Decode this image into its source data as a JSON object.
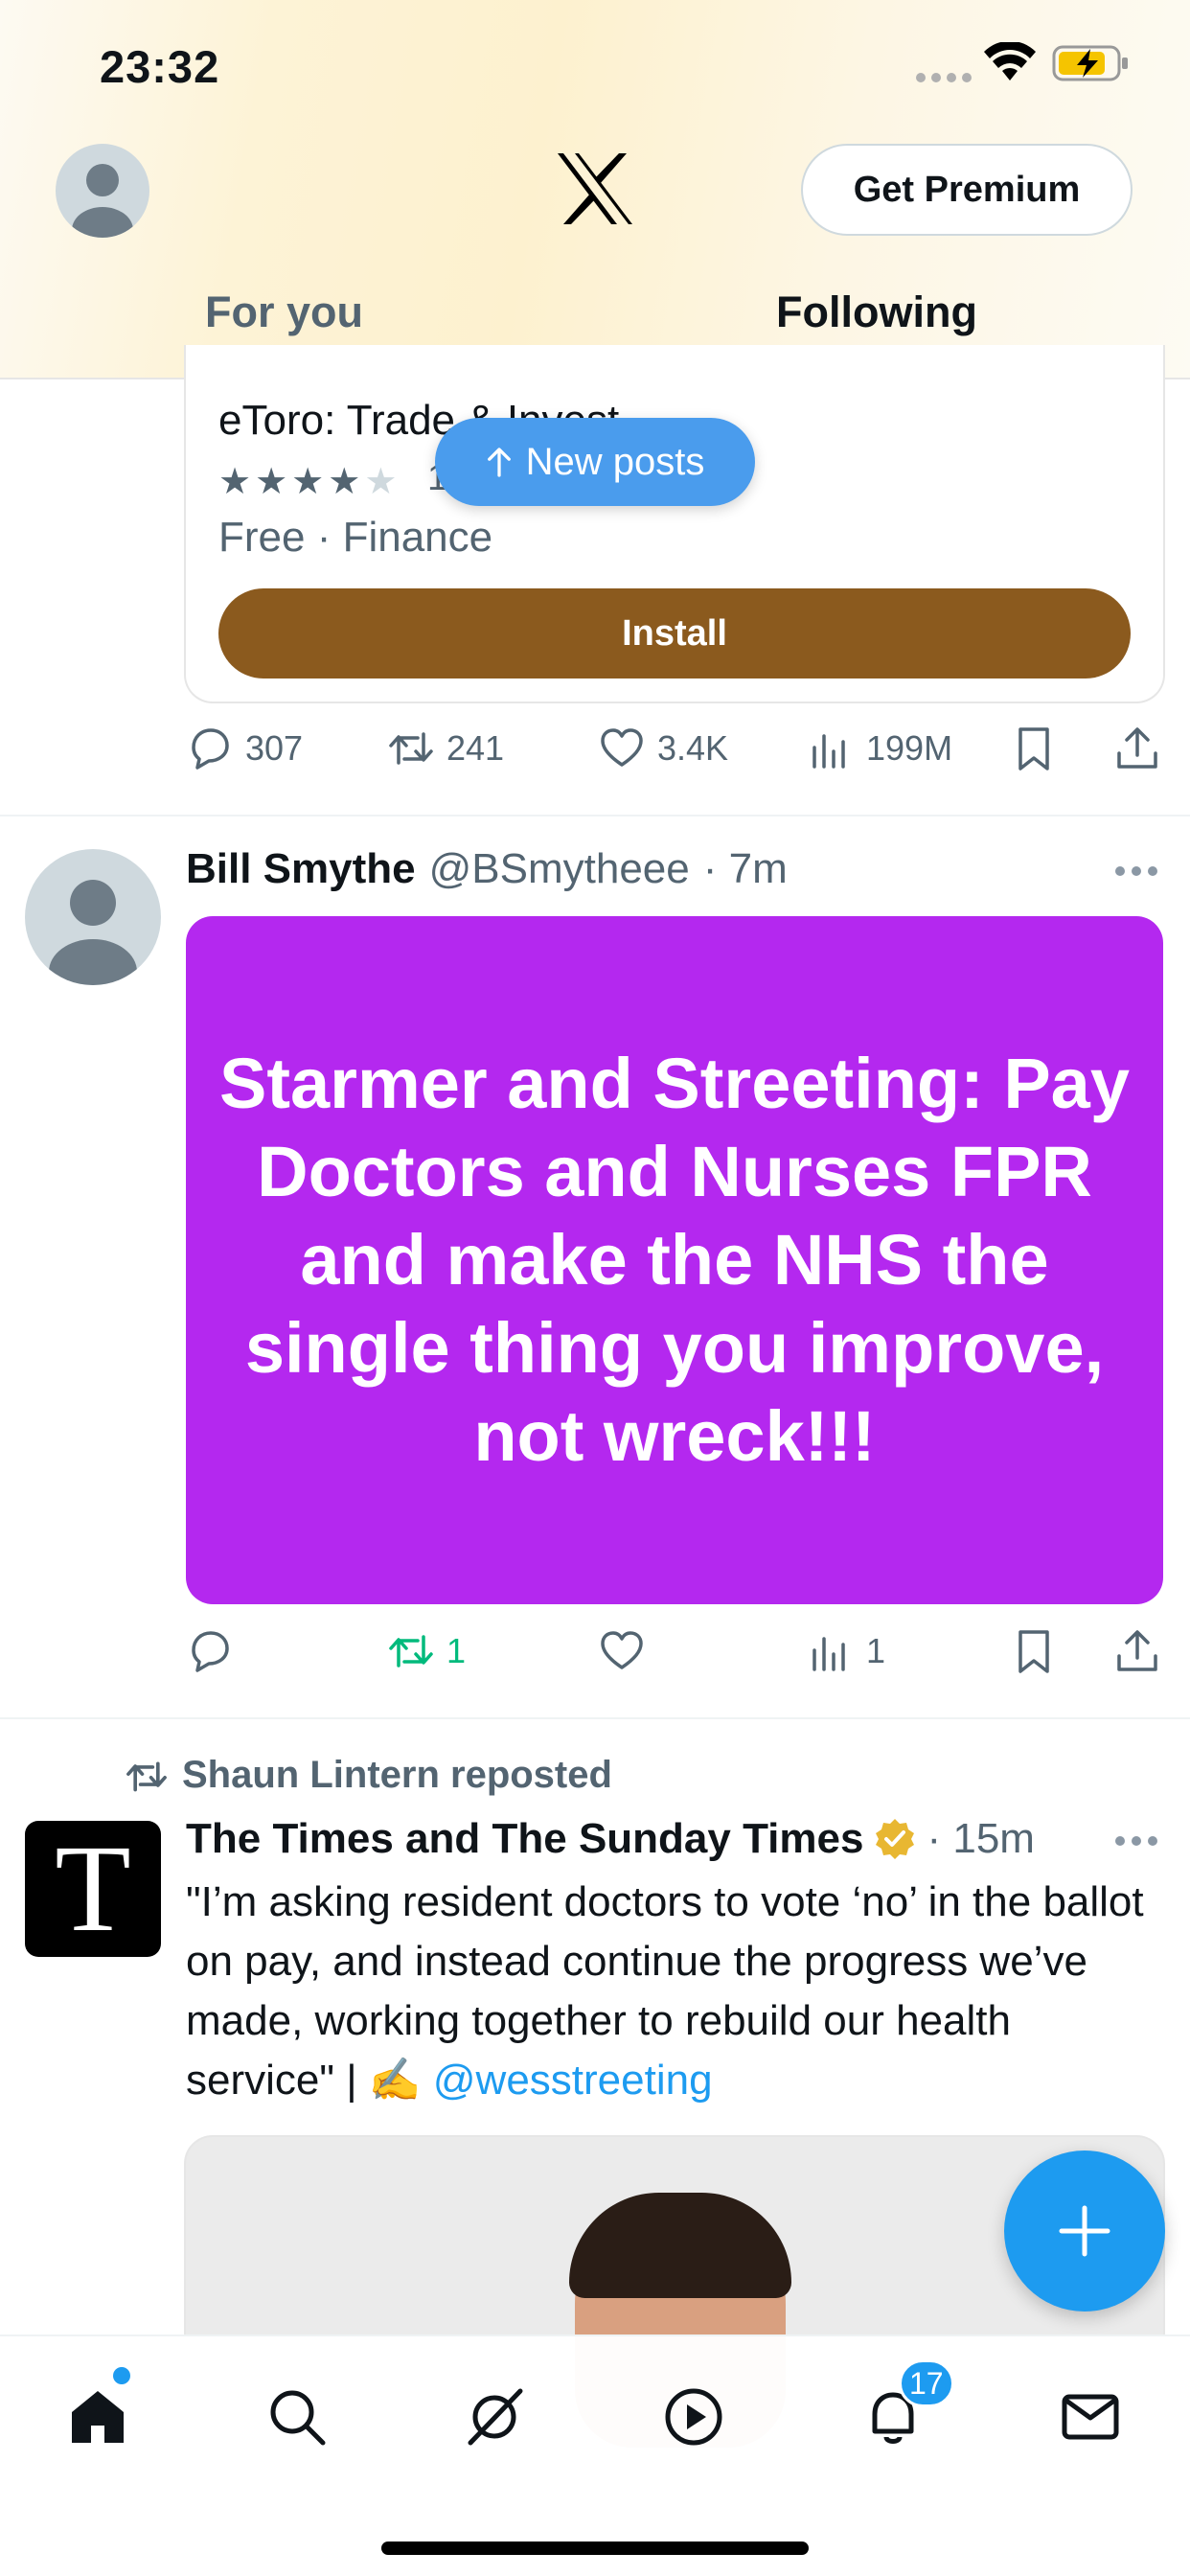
{
  "status_bar": {
    "time": "23:32"
  },
  "header": {
    "premium_label": "Get Premium",
    "tabs": [
      {
        "label": "For you",
        "active": false
      },
      {
        "label": "Following",
        "active": true
      }
    ]
  },
  "ad": {
    "app_name": "eToro: Trade & Invest",
    "stars_filled": 4,
    "stars_total": 5,
    "rating_count_partial": "1",
    "meta": "Free · Finance",
    "install_label": "Install",
    "actions": {
      "replies": "307",
      "reposts": "241",
      "likes": "3.4K",
      "views": "199M"
    }
  },
  "new_posts_label": "New posts",
  "tweets": [
    {
      "name": "Bill Smythe",
      "handle": "@BSmytheee",
      "time": "· 7m",
      "image_text": "Starmer and Streeting: Pay Doctors and Nurses FPR and make the NHS the single thing you improve, not wreck!!!",
      "actions": {
        "replies": "",
        "reposts": "1",
        "likes": "",
        "views": "1"
      }
    },
    {
      "reposted_by": "Shaun Lintern reposted",
      "name": "The Times and The Sunday Times",
      "handle": "",
      "time": "· 15m",
      "logo_letter": "T",
      "text": "\"I’m asking resident doctors to vote ‘no’ in the ballot on pay, and instead continue the progress we’ve made, working together to rebuild our health service\" | ✍️ ",
      "mention": "@wesstreeting"
    }
  ],
  "bottom_nav": {
    "notifications_count": "17"
  },
  "colors": {
    "accent": "#1d9bf0",
    "install": "#8b5a1e",
    "promo_bg": "#b428ef",
    "repost_green": "#00ba7c"
  }
}
